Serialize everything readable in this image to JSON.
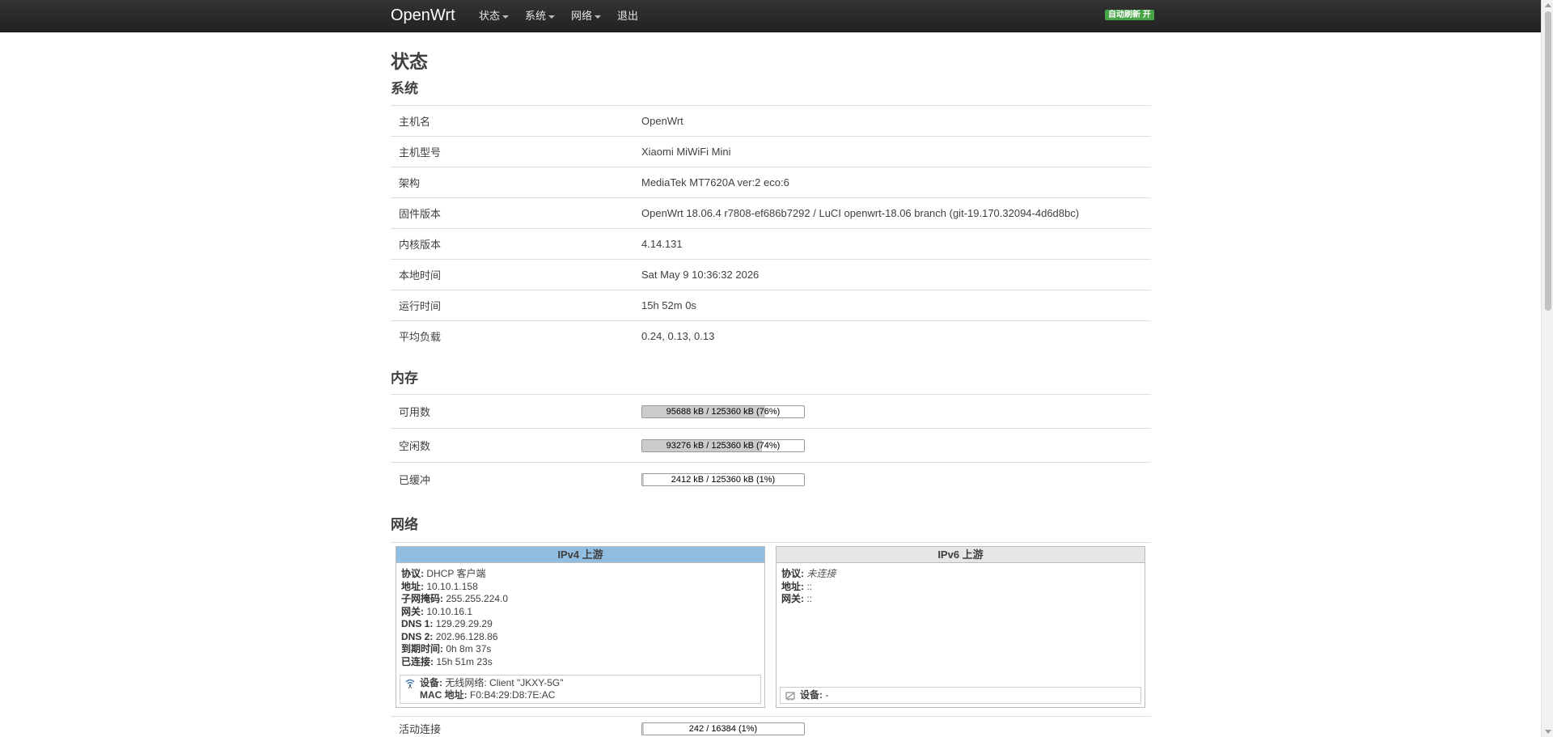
{
  "navbar": {
    "brand": "OpenWrt",
    "menu": [
      "状态",
      "系统",
      "网络",
      "退出"
    ],
    "autorefresh": "自动刷新 开"
  },
  "page_title": "状态",
  "system": {
    "title": "系统",
    "rows": [
      {
        "key": "主机名",
        "value": "OpenWrt"
      },
      {
        "key": "主机型号",
        "value": "Xiaomi MiWiFi Mini"
      },
      {
        "key": "架构",
        "value": "MediaTek MT7620A ver:2 eco:6"
      },
      {
        "key": "固件版本",
        "value": "OpenWrt 18.06.4 r7808-ef686b7292 / LuCI openwrt-18.06 branch (git-19.170.32094-4d6d8bc)"
      },
      {
        "key": "内核版本",
        "value": "4.14.131"
      },
      {
        "key": "本地时间",
        "value": "Sat May 9 10:36:32 2026"
      },
      {
        "key": "运行时间",
        "value": "15h 52m 0s"
      },
      {
        "key": "平均负载",
        "value": "0.24, 0.13, 0.13"
      }
    ]
  },
  "memory": {
    "title": "内存",
    "rows": [
      {
        "key": "可用数",
        "text": "95688 kB / 125360 kB (76%)",
        "percent": 76
      },
      {
        "key": "空闲数",
        "text": "93276 kB / 125360 kB (74%)",
        "percent": 74
      },
      {
        "key": "已缓冲",
        "text": "2412 kB / 125360 kB (1%)",
        "percent": 1
      }
    ]
  },
  "network": {
    "title": "网络",
    "ipv4": {
      "header": "IPv4 上游",
      "header_color": "#90bde0",
      "fields": [
        {
          "label": "协议:",
          "value": "DHCP 客户端"
        },
        {
          "label": "地址:",
          "value": "10.10.1.158"
        },
        {
          "label": "子网掩码:",
          "value": "255.255.224.0"
        },
        {
          "label": "网关:",
          "value": "10.10.16.1"
        },
        {
          "label": "DNS 1:",
          "value": "129.29.29.29"
        },
        {
          "label": "DNS 2:",
          "value": "202.96.128.86"
        },
        {
          "label": "到期时间:",
          "value": "0h 8m 37s"
        },
        {
          "label": "已连接:",
          "value": "15h 51m 23s"
        }
      ],
      "device_label": "设备:",
      "device_value": "无线网络: Client \"JKXY-5G\"",
      "mac_label": "MAC 地址:",
      "mac_value": "F0:B4:29:D8:7E:AC"
    },
    "ipv6": {
      "header": "IPv6 上游",
      "header_color": "#e6e6e6",
      "fields": [
        {
          "label": "协议:",
          "value": "未连接"
        },
        {
          "label": "地址:",
          "value": "::"
        },
        {
          "label": "网关:",
          "value": "::"
        }
      ],
      "device_label": "设备:",
      "device_value": "-"
    },
    "active_connections": {
      "key": "活动连接",
      "text": "242 / 16384 (1%)",
      "percent": 1
    }
  }
}
